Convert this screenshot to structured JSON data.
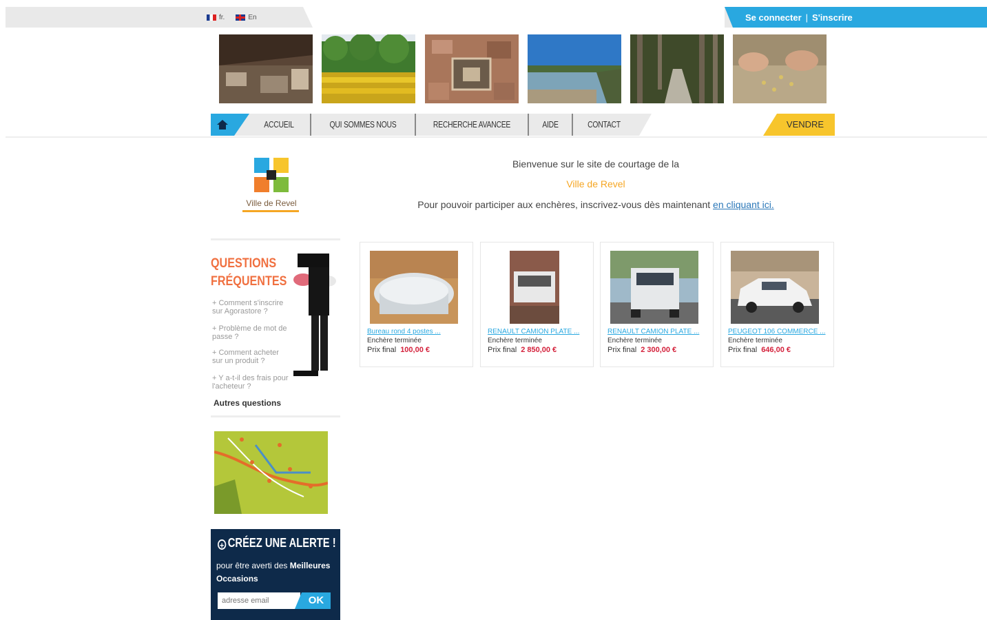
{
  "languages": [
    {
      "code": "fr",
      "label": "fr."
    },
    {
      "code": "en",
      "label": "En"
    }
  ],
  "account": {
    "login": "Se connecter",
    "separator": "|",
    "register": "S'inscrire"
  },
  "nav": {
    "home_icon": "home-icon",
    "items": [
      "ACCUEIL",
      "QUI SOMMES NOUS",
      "RECHERCHE AVANCEE",
      "AIDE",
      "CONTACT"
    ],
    "sell": "VENDRE"
  },
  "logo": {
    "text": "Ville de Revel"
  },
  "welcome": {
    "line1": "Bienvenue sur le site de courtage de la",
    "city": "Ville de Revel",
    "line3": "Pour pouvoir participer aux enchères, inscrivez-vous dès maintenant",
    "link": "en cliquant ici."
  },
  "faq": {
    "title_line1": "QUESTIONS",
    "title_line2": "FRÉQUENTES",
    "questions": [
      "Comment s'inscrire sur Agorastore ?",
      "Problème de mot de passe ?",
      "Comment acheter sur un produit ?",
      "Y a-t-il des frais pour l'acheteur ?"
    ],
    "more": "Autres questions"
  },
  "alert": {
    "title": "CRÉEZ UNE ALERTE !",
    "subtitle_plain": "pour être averti des",
    "subtitle_bold": "Meilleures Occasions",
    "input_placeholder": "adresse email",
    "button": "OK"
  },
  "products": [
    {
      "title": "Bureau rond 4 postes ...",
      "status": "Enchère terminée",
      "price_label": "Prix final",
      "price": "100,00 €"
    },
    {
      "title": "RENAULT CAMION PLATE ...",
      "status": "Enchère terminée",
      "price_label": "Prix final",
      "price": "2 850,00 €"
    },
    {
      "title": "RENAULT CAMION PLATE ...",
      "status": "Enchère terminée",
      "price_label": "Prix final",
      "price": "2 300,00 €"
    },
    {
      "title": "PEUGEOT 106 COMMERCE ...",
      "status": "Enchère terminée",
      "price_label": "Prix final",
      "price": "646,00 €"
    }
  ],
  "colors": {
    "accent_blue": "#29a8e0",
    "sell_yellow": "#f7c52c",
    "faq_orange": "#f07040",
    "price_red": "#d4213b",
    "alert_navy": "#0e2a4a"
  }
}
